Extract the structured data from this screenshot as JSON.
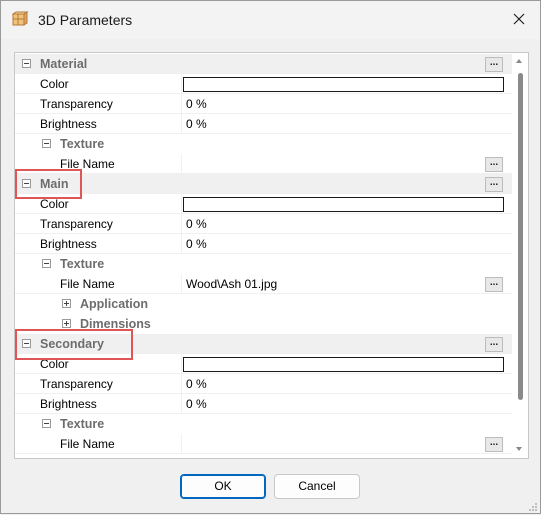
{
  "window": {
    "title": "3D Parameters",
    "icon": "3d-cube-icon",
    "close_icon": "close-icon"
  },
  "property_grid": {
    "dots_label": "...",
    "rows": [
      {
        "kind": "category",
        "label": "Material",
        "toggle": "minus",
        "dots": true
      },
      {
        "kind": "prop",
        "name": "Color",
        "value": "",
        "color_box": true
      },
      {
        "kind": "prop",
        "name": "Transparency",
        "value": "0 %"
      },
      {
        "kind": "prop",
        "name": "Brightness",
        "value": "0 %"
      },
      {
        "kind": "subcategory",
        "label": "Texture",
        "toggle": "minus"
      },
      {
        "kind": "prop",
        "name": "File Name",
        "value": "",
        "indent": true,
        "dots": true
      },
      {
        "kind": "category",
        "label": "Main",
        "toggle": "minus",
        "dots": true
      },
      {
        "kind": "prop",
        "name": "Color",
        "value": "",
        "color_box": true
      },
      {
        "kind": "prop",
        "name": "Transparency",
        "value": "0 %"
      },
      {
        "kind": "prop",
        "name": "Brightness",
        "value": "0 %"
      },
      {
        "kind": "subcategory",
        "label": "Texture",
        "toggle": "minus"
      },
      {
        "kind": "prop",
        "name": "File Name",
        "value": "Wood\\Ash 01.jpg",
        "indent": true,
        "dots": true
      },
      {
        "kind": "subcategory2",
        "label": "Application",
        "toggle": "plus"
      },
      {
        "kind": "subcategory2",
        "label": "Dimensions",
        "toggle": "plus"
      },
      {
        "kind": "category",
        "label": "Secondary",
        "toggle": "minus",
        "dots": true
      },
      {
        "kind": "prop",
        "name": "Color",
        "value": "",
        "color_box": true
      },
      {
        "kind": "prop",
        "name": "Transparency",
        "value": "0 %"
      },
      {
        "kind": "prop",
        "name": "Brightness",
        "value": "0 %"
      },
      {
        "kind": "subcategory",
        "label": "Texture",
        "toggle": "minus"
      },
      {
        "kind": "prop",
        "name": "File Name",
        "value": "",
        "indent": true,
        "dots": true
      }
    ]
  },
  "buttons": {
    "ok_label": "OK",
    "cancel_label": "Cancel"
  },
  "colors": {
    "highlight": "#e05555",
    "accent": "#0067c0",
    "category_bg": "#f0f0f0"
  }
}
